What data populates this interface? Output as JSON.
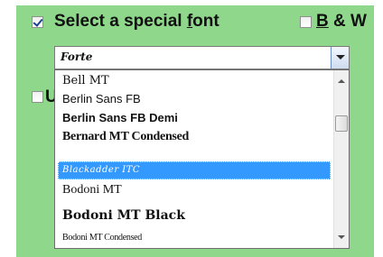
{
  "header": {
    "special_font_label_pre": "Select a special ",
    "special_font_label_accel": "f",
    "special_font_label_post": "ont",
    "special_font_checked": true,
    "bw_label_accel": "B",
    "bw_label_post": " & W",
    "bw_checked": false
  },
  "second_option": {
    "label_visible_fragment": "U",
    "checked": false
  },
  "font_combo": {
    "value": "Forte"
  },
  "font_list": {
    "items": [
      {
        "label": "Bell MT"
      },
      {
        "label": "Berlin Sans FB"
      },
      {
        "label": "Berlin Sans FB Demi"
      },
      {
        "label": "Bernard MT Condensed"
      },
      {
        "label": "Blackadder ITC"
      },
      {
        "label": "Bodoni MT"
      },
      {
        "label": "Bodoni MT Black"
      },
      {
        "label": "Bodoni MT Condensed"
      }
    ],
    "selected_label": "Blackadder ITC"
  },
  "colors": {
    "panel_background": "#8fd88b",
    "selection_highlight": "#3399ff"
  },
  "icons": {
    "combo_arrow": "chevron-down-icon",
    "scroll_up": "arrow-up-icon",
    "scroll_down": "arrow-down-icon"
  }
}
